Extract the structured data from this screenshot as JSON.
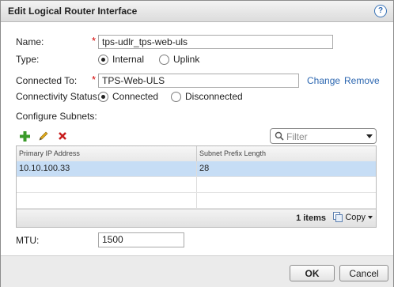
{
  "dialog": {
    "title": "Edit Logical Router Interface",
    "help_icon": "help-icon"
  },
  "form": {
    "name_label": "Name:",
    "name_value": "tps-udlr_tps-web-uls",
    "type_label": "Type:",
    "type_options": [
      "Internal",
      "Uplink"
    ],
    "type_selected": "Internal",
    "connected_to_label": "Connected To:",
    "connected_to_value": "TPS-Web-ULS",
    "change_link": "Change",
    "remove_link": "Remove",
    "connectivity_label": "Connectivity Status:",
    "connectivity_options": [
      "Connected",
      "Disconnected"
    ],
    "connectivity_selected": "Connected",
    "configure_subnets_label": "Configure Subnets:",
    "required_marker": "*",
    "mtu_label": "MTU:",
    "mtu_value": "1500"
  },
  "toolbar": {
    "add_icon": "plus-icon",
    "edit_icon": "pencil-icon",
    "delete_icon": "delete-x-icon",
    "filter_placeholder": "Filter"
  },
  "grid": {
    "columns": [
      "Primary IP Address",
      "Subnet Prefix Length"
    ],
    "rows": [
      {
        "ip": "10.10.100.33",
        "prefix": "28"
      }
    ],
    "count_text": "1 items",
    "copy_label": "Copy"
  },
  "buttons": {
    "ok": "OK",
    "cancel": "Cancel"
  },
  "colors": {
    "required": "#d40000",
    "link": "#2b66b0",
    "selected_row": "#c6ddf5",
    "add_icon": "#3a9a2a",
    "delete_icon": "#c81e1e"
  }
}
